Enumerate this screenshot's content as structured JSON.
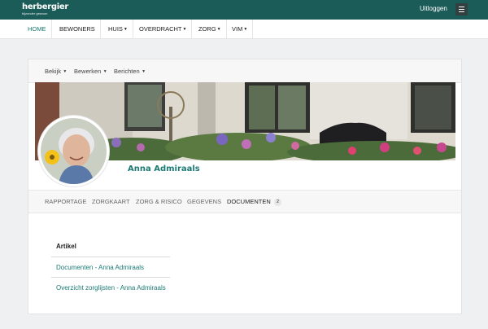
{
  "topbar": {
    "logo_name": "herbergier",
    "logo_tagline": "bijzonder gewoon",
    "logout_label": "Uitloggen",
    "menu_icon": "hamburger-icon",
    "bg_color": "#1c5c58"
  },
  "nav": {
    "items": [
      {
        "label": "HOME",
        "dropdown": false,
        "active": true
      },
      {
        "label": "BEWONERS",
        "dropdown": false,
        "active": false
      },
      {
        "label": "HUIS",
        "dropdown": true,
        "active": false
      },
      {
        "label": "OVERDRACHT",
        "dropdown": true,
        "active": false
      },
      {
        "label": "ZORG",
        "dropdown": true,
        "active": false
      },
      {
        "label": "VIM",
        "dropdown": true,
        "active": false
      }
    ]
  },
  "actions": {
    "view_label": "Bekijk",
    "edit_label": "Bewerken",
    "messages_label": "Berichten"
  },
  "profile": {
    "name": "Anna Admiraals",
    "banner_image": "house-front-with-garden-flowers-and-bench",
    "avatar_image": "smiling-elderly-woman-portrait"
  },
  "tabs": {
    "items": [
      {
        "label": "RAPPORTAGE",
        "active": false
      },
      {
        "label": "ZORGKAART",
        "active": false
      },
      {
        "label": "ZORG & RISICO",
        "active": false
      },
      {
        "label": "GEGEVENS",
        "active": false
      },
      {
        "label": "DOCUMENTEN",
        "active": true
      }
    ],
    "documents_count": "2"
  },
  "articles": {
    "header": "Artikel",
    "rows": [
      {
        "title": "Documenten - Anna Admiraals"
      },
      {
        "title": "Overzicht zorglijsten - Anna Admiraals"
      }
    ]
  },
  "colors": {
    "accent": "#1c7a75",
    "page_bg": "#eef0f2"
  }
}
